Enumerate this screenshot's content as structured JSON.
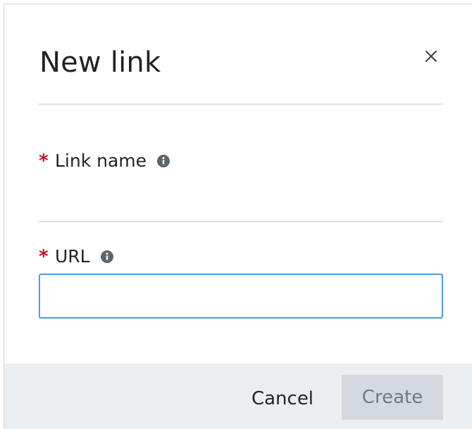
{
  "dialog": {
    "title": "New link",
    "close_icon": "close-icon"
  },
  "fields": {
    "link_name": {
      "label": "Link name",
      "required_marker": "*",
      "info_icon": "info-icon",
      "value": ""
    },
    "url": {
      "label": "URL",
      "required_marker": "*",
      "info_icon": "info-icon",
      "value": "",
      "placeholder": ""
    }
  },
  "footer": {
    "cancel_label": "Cancel",
    "create_label": "Create"
  },
  "colors": {
    "required": "#c8102e",
    "input_focus_border": "#4e9ad4",
    "footer_bg": "#eceff1",
    "disabled_button_bg": "#d3d9de",
    "disabled_button_text": "#6f7a83"
  }
}
